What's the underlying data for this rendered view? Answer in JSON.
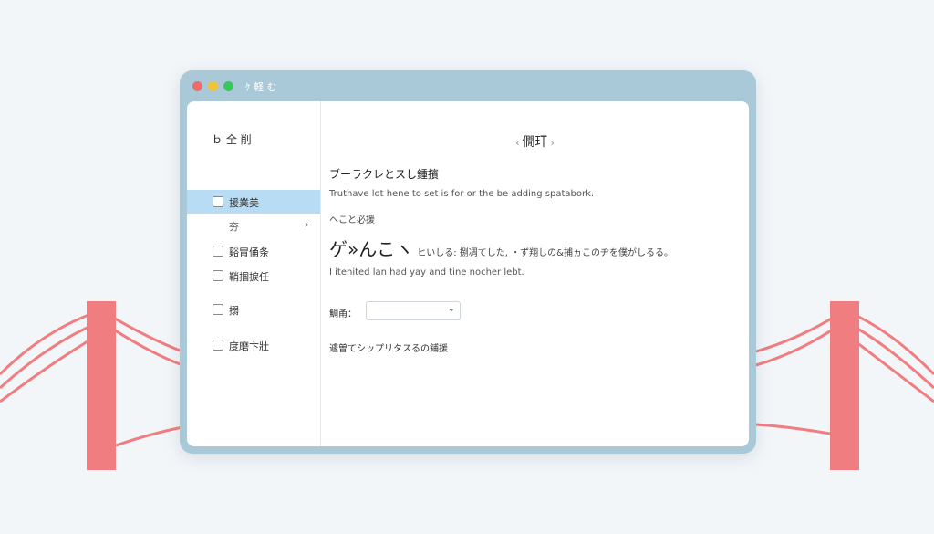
{
  "window": {
    "title": "ｹ 軽 む"
  },
  "sidebar": {
    "header": "ｂ 全 削",
    "items": [
      {
        "label": "援業美",
        "active": true
      },
      {
        "label": "谿胃俑条"
      },
      {
        "label": "鞘掴捩任"
      },
      {
        "label": "搦"
      },
      {
        "label": "度磨卞壯"
      }
    ],
    "sub_item": {
      "label": "夯",
      "chevron": "›"
    }
  },
  "main": {
    "title": "僩玕",
    "prev_arrow": "‹",
    "next_arrow": "›",
    "heading": "ブーラクレとスし鍾擯",
    "description": "Truthave lot hene to set is for or the be adding spatabork.",
    "subheading": "ヘこと必援",
    "large_text": "ゲ»んこヽ",
    "large_text_tail": "ヒいしる: 捌凋てした, ・ず翔しの&捕ヵこのヂを僕がしるる。",
    "note": "I itenited lan had yay and tine nocher lebt.",
    "select_label": "鯛甬：",
    "select_value": "",
    "select_chevron": "⌄",
    "footer": "遽曽てシップリタスるの鋪援"
  },
  "colors": {
    "background": "#f3f6f9",
    "window_frame": "#a9c9d8",
    "active_item": "#b8dcf3",
    "bridge": "#f07d80",
    "close": "#ef6a6a",
    "minimize": "#f1c23c",
    "maximize": "#38c75b"
  }
}
